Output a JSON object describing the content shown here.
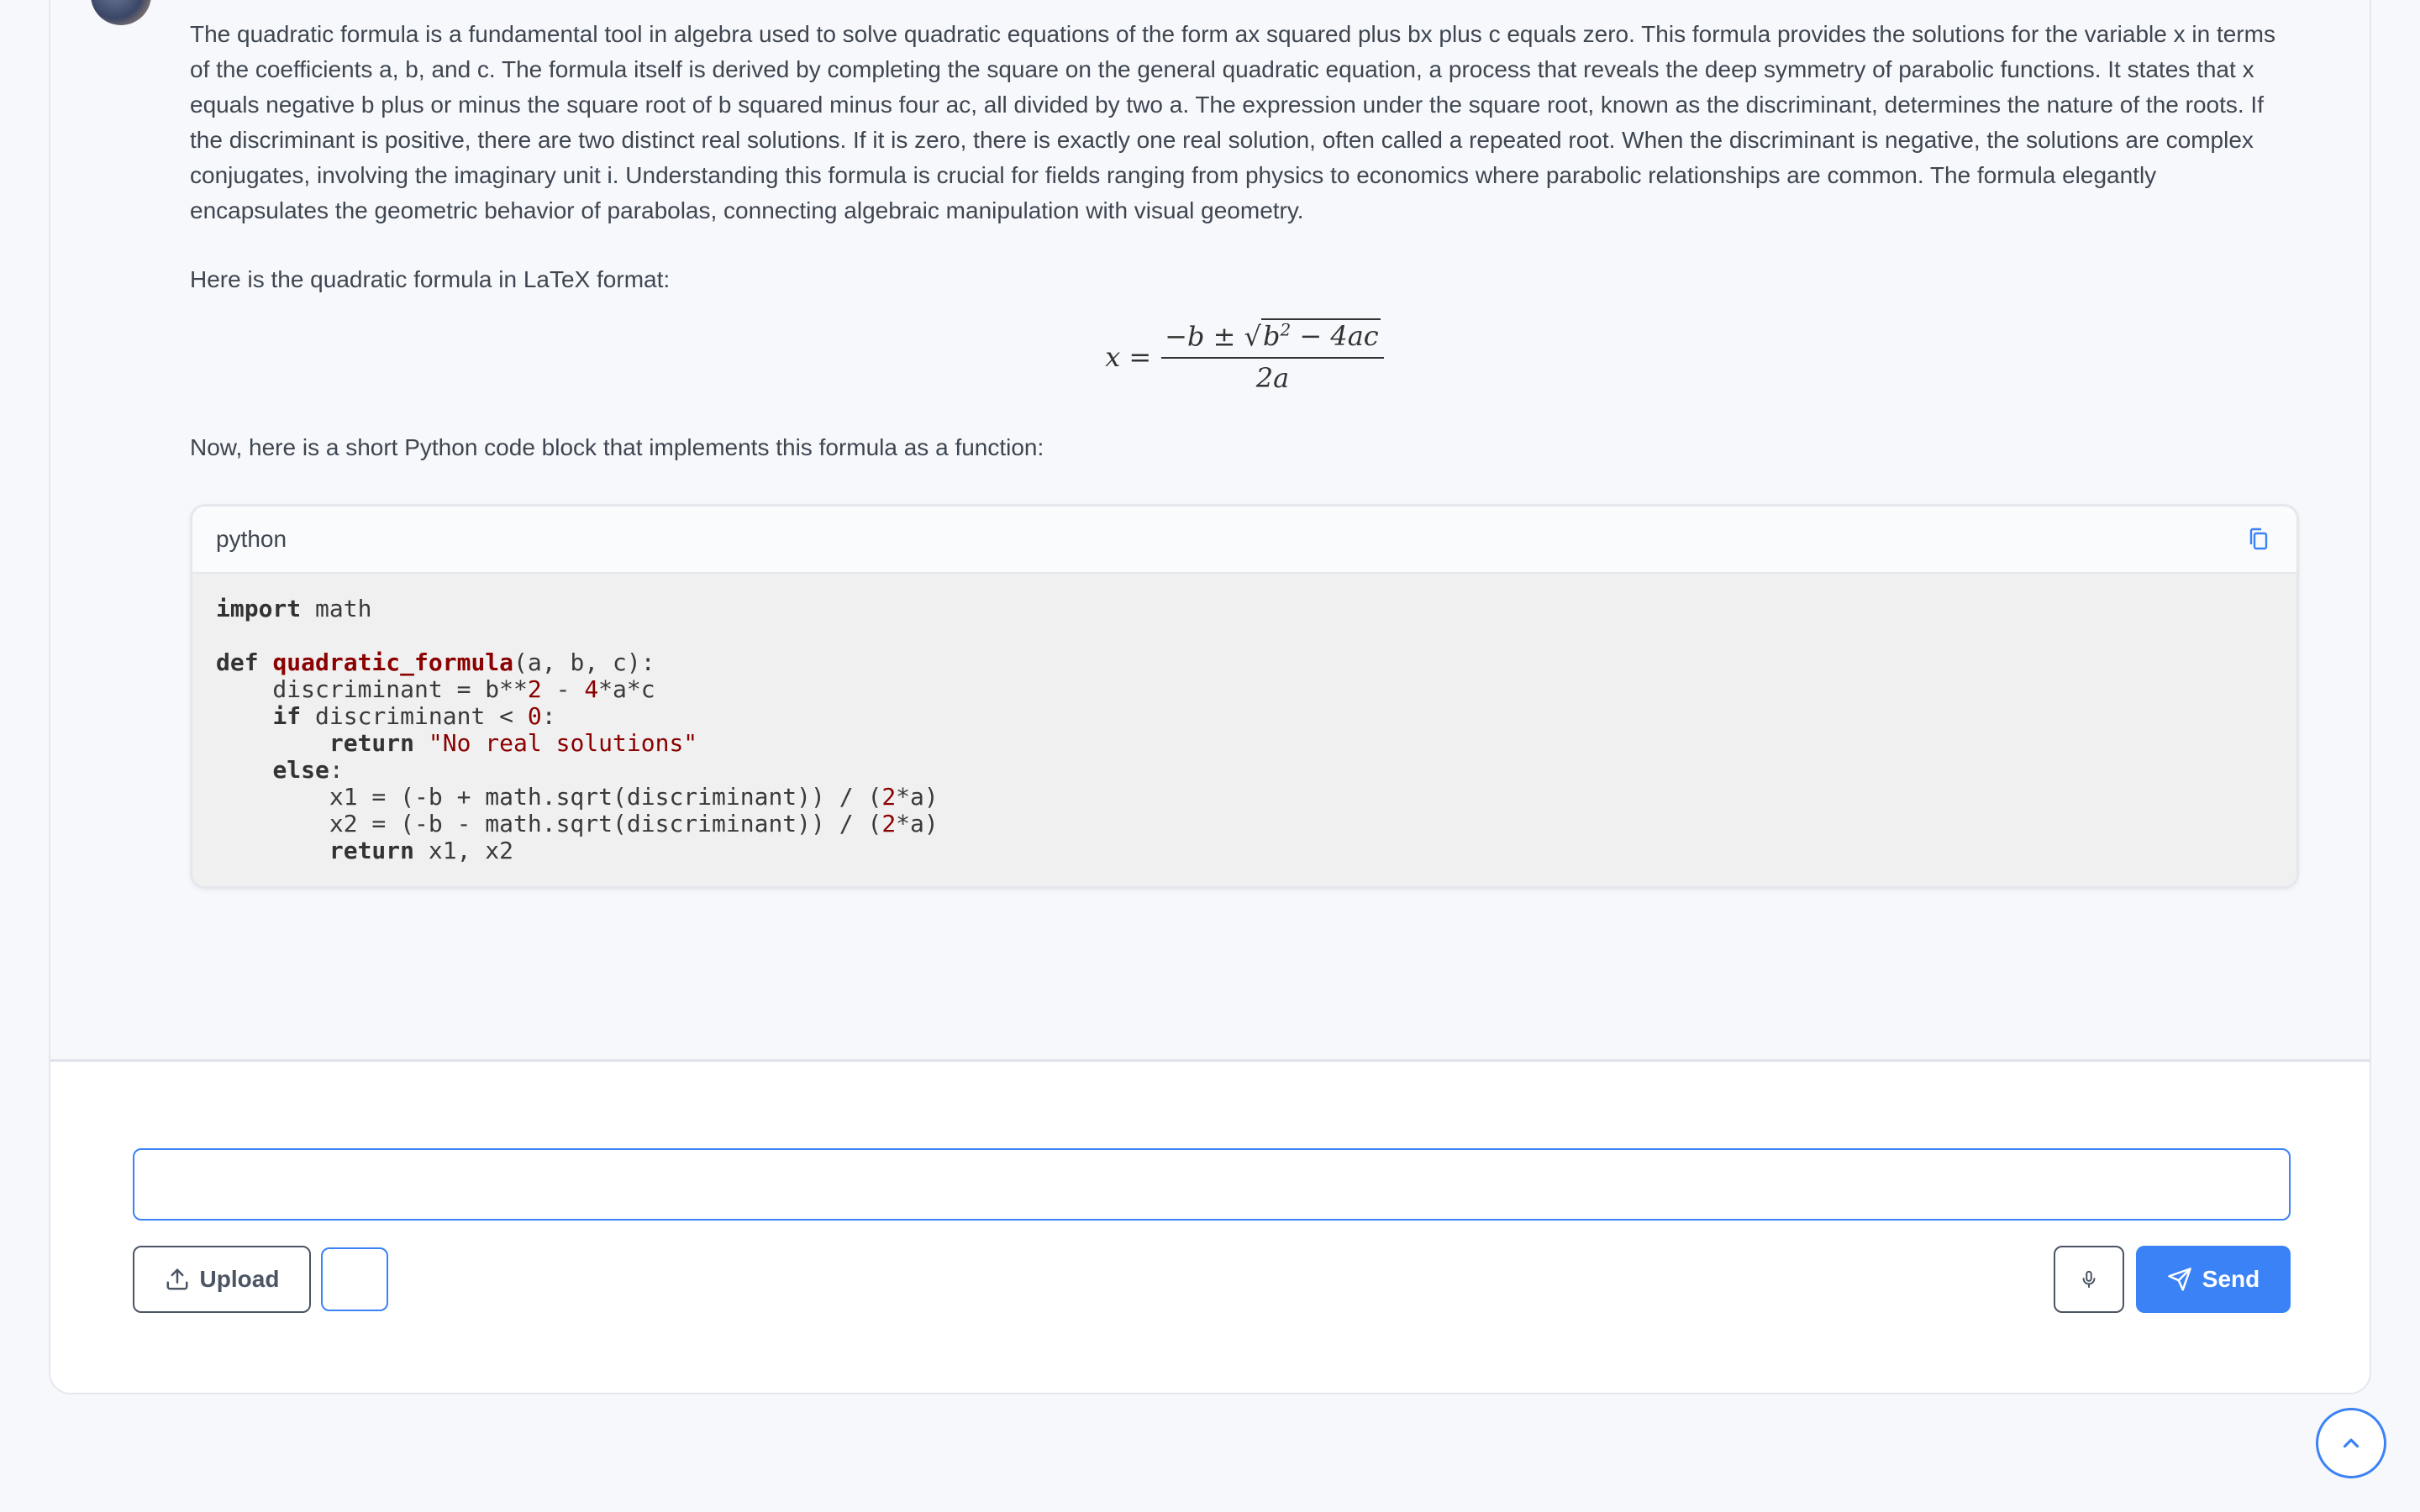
{
  "message": {
    "sender_meta": "",
    "intro": "The quadratic formula is a fundamental tool in algebra used to solve quadratic equations of the form ax squared plus bx plus c equals zero. This formula provides the solutions for the variable x in terms of the coefficients a, b, and c. The formula itself is derived by completing the square on the general quadratic equation, a process that reveals the deep symmetry of parabolic functions. It states that x equals negative b plus or minus the square root of b squared minus four ac, all divided by two a. The expression under the square root, known as the discriminant, determines the nature of the roots. If the discriminant is positive, there are two distinct real solutions. If it is zero, there is exactly one real solution, often called a repeated root. When the discriminant is negative, the solutions are complex conjugates, involving the imaginary unit i. Understanding this formula is crucial for fields ranging from physics to economics where parabolic relationships are common. The formula elegantly encapsulates the geometric behavior of parabolas, connecting algebraic manipulation with visual geometry.",
    "latex_intro": "Here is the quadratic formula in LaTeX format:",
    "formula": {
      "lhs": "x",
      "eq": "=",
      "num_prefix": "−b ± √",
      "radicand_base": "b",
      "radicand_exp": "2",
      "radicand_rest": " − 4ac",
      "denominator": "2a"
    },
    "code_intro": "Now, here is a short Python code block that implements this formula as a function:",
    "code": {
      "language": "python",
      "copy_icon": "copy-icon"
    }
  },
  "composer": {
    "input_value": "",
    "input_placeholder": "",
    "upload_label": "Upload",
    "send_label": "Send"
  },
  "colors": {
    "accent": "#3b82f6",
    "code_bg": "#f0f0f0",
    "code_highlight": "#8b0000"
  }
}
